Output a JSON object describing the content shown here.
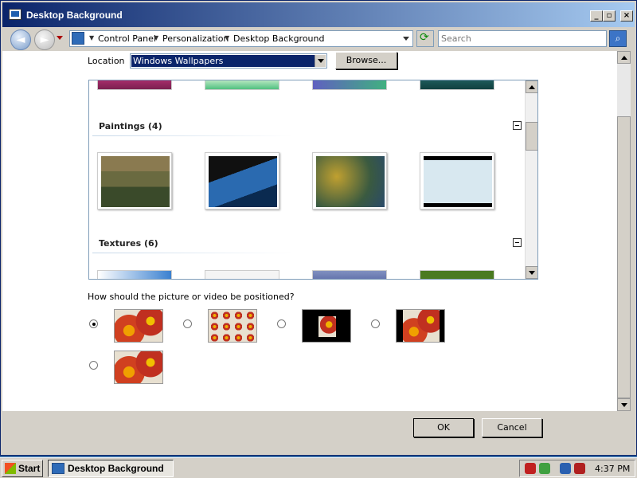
{
  "window": {
    "title": "Desktop Background",
    "min": "_",
    "max": "▫",
    "close": "×"
  },
  "nav": {
    "back": "◄",
    "forward": "►",
    "breadcrumb": [
      "Control Panel",
      "Personalization",
      "Desktop Background"
    ],
    "search_placeholder": "Search",
    "search_btn": "⌕"
  },
  "location": {
    "label": "Location",
    "value": "Windows Wallpapers",
    "browse": "Browse..."
  },
  "gallery": {
    "groups": [
      {
        "title": "Paintings (4)"
      },
      {
        "title": "Textures (6)"
      }
    ]
  },
  "position": {
    "question": "How should the picture or video be positioned?",
    "selected_index": 0
  },
  "buttons": {
    "ok": "OK",
    "cancel": "Cancel"
  },
  "taskbar": {
    "start": "Start",
    "task": "Desktop Background",
    "clock": "4:37 PM"
  }
}
